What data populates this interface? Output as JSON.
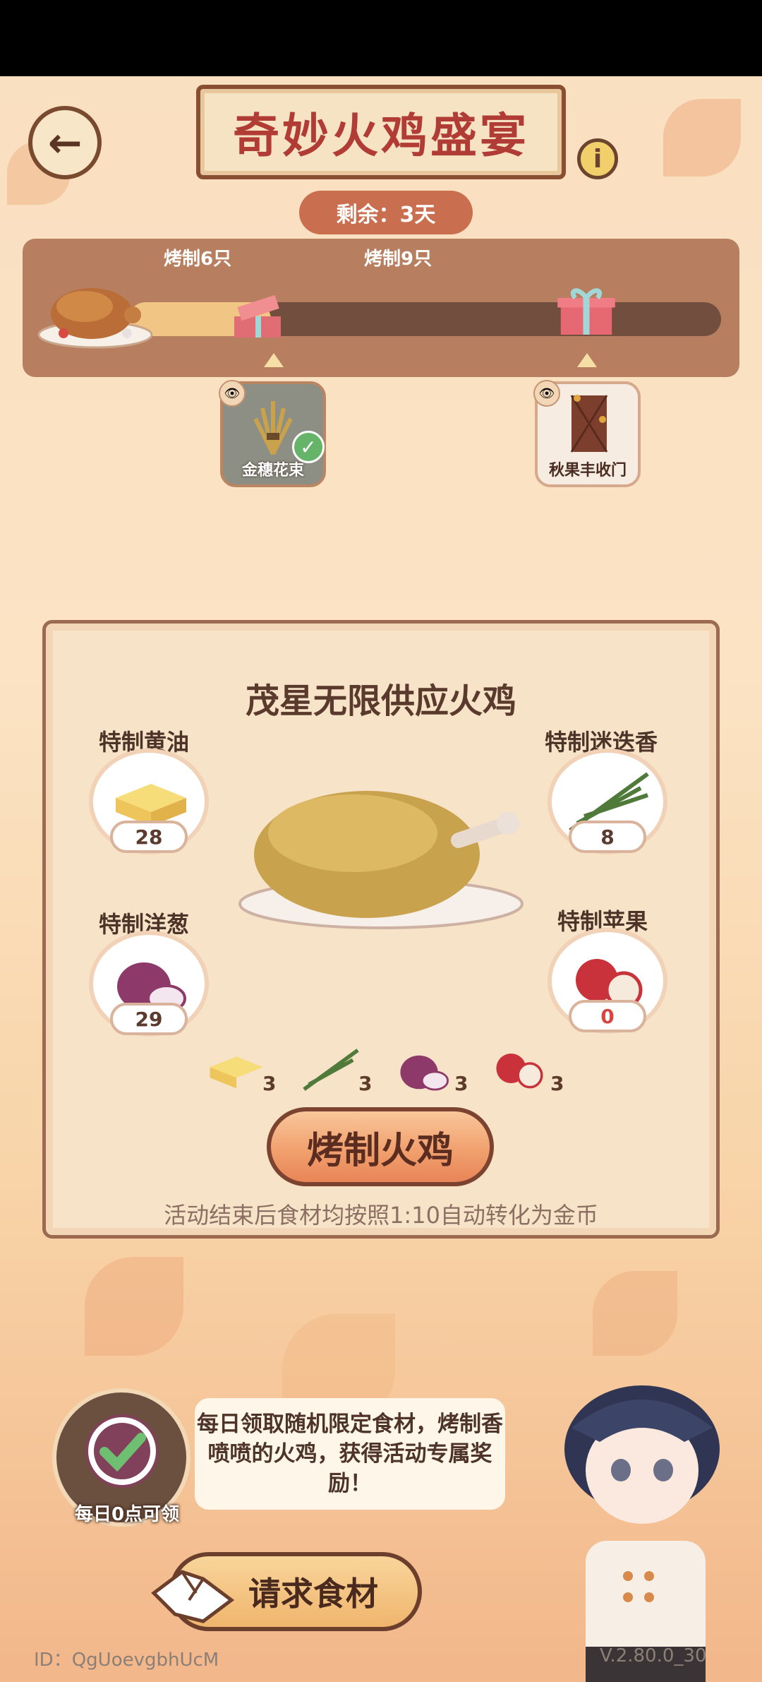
{
  "event": {
    "title": "奇妙火鸡盛宴",
    "remaining": "剩余：3天"
  },
  "progress": {
    "fill_fraction": 0.24,
    "milestones": [
      {
        "label": "烤制6只"
      },
      {
        "label": "烤制9只"
      }
    ]
  },
  "rewards": [
    {
      "name": "金穗花束",
      "claimed": true
    },
    {
      "name": "秋果丰收门",
      "claimed": false
    }
  ],
  "panel": {
    "title": "茂星无限供应火鸡",
    "ingredients": [
      {
        "name": "特制黄油",
        "count": "28"
      },
      {
        "name": "特制迷迭香",
        "count": "8"
      },
      {
        "name": "特制洋葱",
        "count": "29"
      },
      {
        "name": "特制苹果",
        "count": "0"
      }
    ],
    "costs": [
      "3",
      "3",
      "3",
      "3"
    ],
    "roast_button": "烤制火鸡",
    "note": "活动结束后食材均按照1:10自动转化为金币"
  },
  "daily": {
    "label": "每日0点可领",
    "bubble_text": "每日领取随机限定食材，烤制香喷喷的火鸡，获得活动专属奖励！",
    "request_button": "请求食材"
  },
  "footer": {
    "user_id": "ID：QgUoevgbhUcM",
    "version": "V.2.80.0_30"
  },
  "colors": {
    "title_red": "#b13b35",
    "progress_panel": "#b57b5d",
    "panel_bg": "#f6e3c8",
    "button_orange": "#f1a06e"
  },
  "icons": [
    "back-arrow-icon",
    "info-icon",
    "eye-icon",
    "check-icon",
    "gift-icon",
    "turkey-icon",
    "handshake-icon"
  ]
}
